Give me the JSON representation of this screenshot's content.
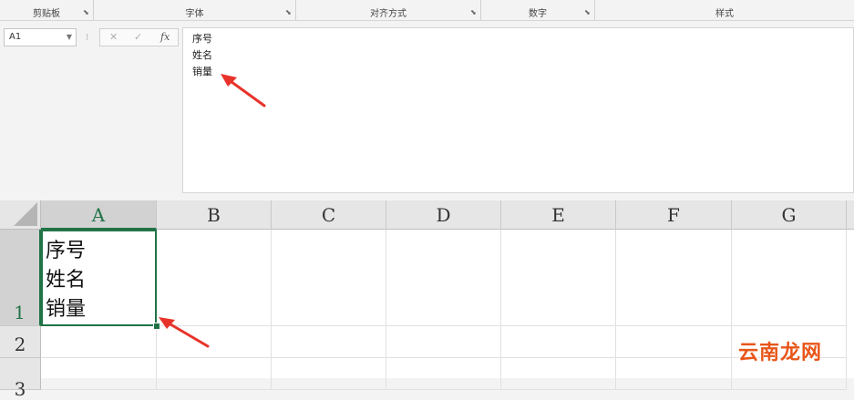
{
  "ribbon": {
    "groups": [
      {
        "label": "剪贴板"
      },
      {
        "label": "字体"
      },
      {
        "label": "对齐方式"
      },
      {
        "label": "数字"
      },
      {
        "label": "样式"
      }
    ]
  },
  "formula_bar": {
    "name_box": "A1",
    "cancel_symbol": "✕",
    "enter_symbol": "✓",
    "fx_symbol": "fx",
    "content_lines": [
      "序号",
      "姓名",
      "销量"
    ]
  },
  "grid": {
    "columns": [
      "A",
      "B",
      "C",
      "D",
      "E",
      "F",
      "G"
    ],
    "rows": [
      "1",
      "2",
      "3"
    ],
    "active_cell": "A1",
    "a1_lines": [
      "序号",
      "姓名",
      "销量"
    ]
  },
  "annotation": {
    "arrow_color": "#e8332a"
  },
  "watermark": {
    "text": "云南龙网"
  },
  "colors": {
    "accent": "#217346",
    "header_bg": "#e6e6e6"
  }
}
